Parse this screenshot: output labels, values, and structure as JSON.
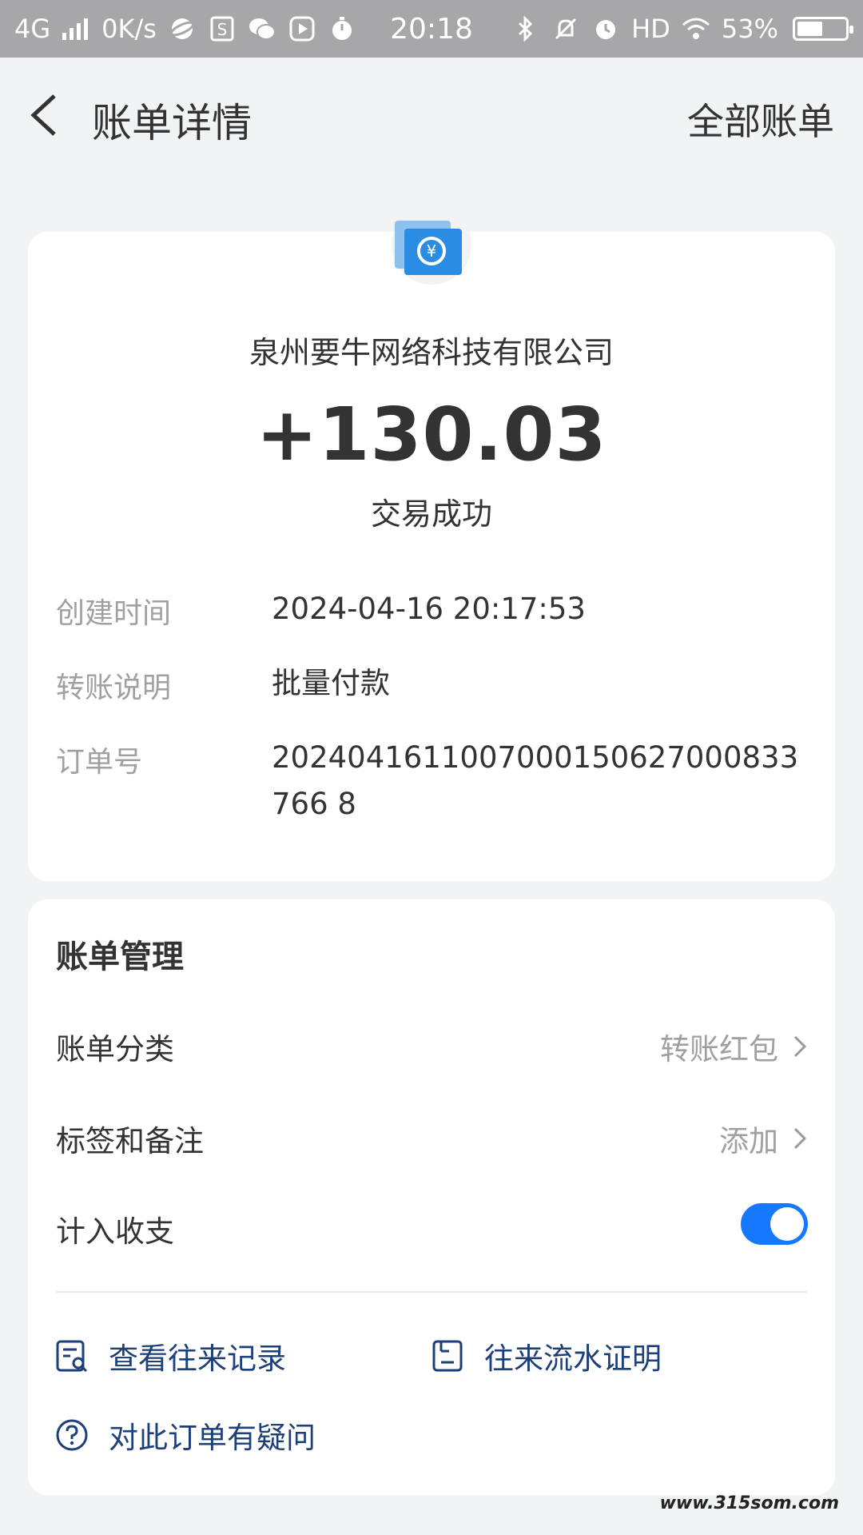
{
  "status_bar": {
    "network": "4G",
    "speed": "0K/s",
    "time": "20:18",
    "hd": "HD",
    "battery": "53%",
    "battery_level": 0.53
  },
  "header": {
    "title": "账单详情",
    "all_bills": "全部账单"
  },
  "transaction": {
    "counterparty": "泉州要牛网络科技有限公司",
    "amount": "+130.03",
    "status": "交易成功",
    "details": [
      {
        "label": "创建时间",
        "value": "2024-04-16 20:17:53"
      },
      {
        "label": "转账说明",
        "value": "批量付款"
      },
      {
        "label": "订单号",
        "value": "2024041611007000150627000833766 8"
      }
    ]
  },
  "management": {
    "title": "账单管理",
    "category_label": "账单分类",
    "category_value": "转账红包",
    "tags_label": "标签和备注",
    "tags_value": "添加",
    "include_label": "计入收支",
    "include_enabled": true,
    "link_records": "查看往来记录",
    "link_proof": "往来流水证明",
    "link_question": "对此订单有疑问"
  },
  "watermark": "www.315som.com",
  "colors": {
    "accent": "#1677ff",
    "link": "#1d3f7a",
    "status_bar": "#a7a7a9"
  }
}
